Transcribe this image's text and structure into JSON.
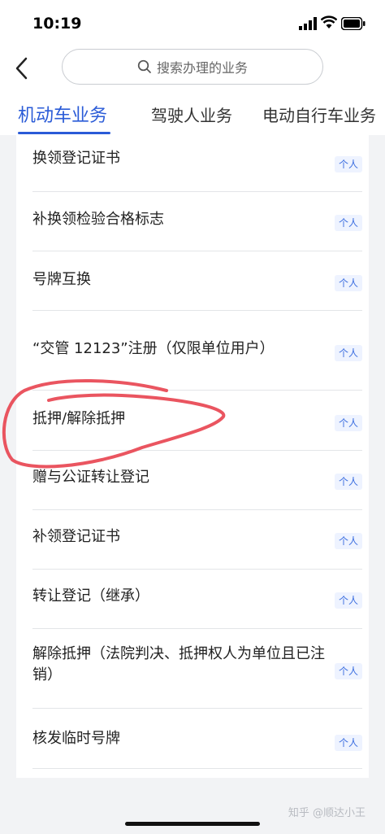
{
  "status_bar": {
    "time": "10:19"
  },
  "search": {
    "placeholder": "搜索办理的业务"
  },
  "tabs": [
    {
      "label": "机动车业务",
      "active": true
    },
    {
      "label": "驾驶人业务",
      "active": false
    },
    {
      "label": "电动自行车业务",
      "active": false
    }
  ],
  "items": [
    {
      "label": "换领登记证书",
      "badge": "个人"
    },
    {
      "label": "补换领检验合格标志",
      "badge": "个人"
    },
    {
      "label": "号牌互换",
      "badge": "个人"
    },
    {
      "label": "“交管 12123”注册（仅限单位用户）",
      "badge": "个人"
    },
    {
      "label": "抵押/解除抵押",
      "badge": "个人"
    },
    {
      "label": "赠与公证转让登记",
      "badge": "个人"
    },
    {
      "label": "补领登记证书",
      "badge": "个人"
    },
    {
      "label": "转让登记（继承）",
      "badge": "个人"
    },
    {
      "label": "解除抵押（法院判决、抵押权人为单位且已注销）",
      "badge": "个人"
    },
    {
      "label": "核发临时号牌",
      "badge": "个人"
    }
  ],
  "watermark": "知乎 @顺达小王",
  "colors": {
    "accent": "#2a5bd7",
    "annotation": "#e8434f"
  }
}
